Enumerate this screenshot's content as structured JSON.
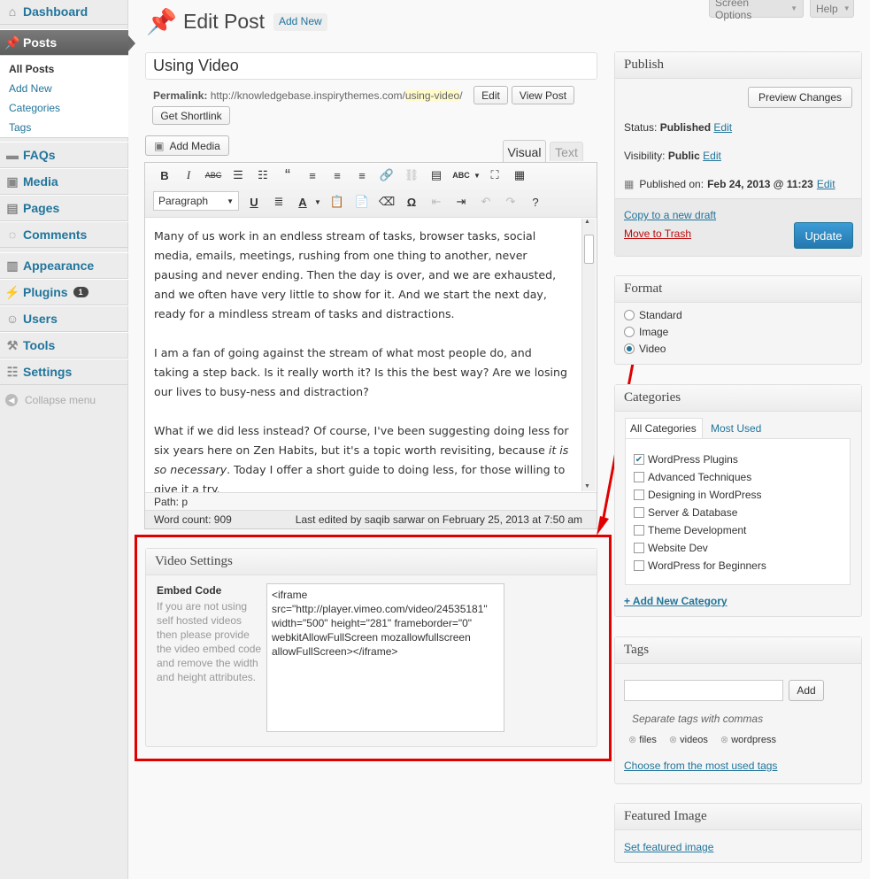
{
  "sidebar": {
    "dashboard": "Dashboard",
    "posts": "Posts",
    "sub_items": [
      "All Posts",
      "Add New",
      "Categories",
      "Tags"
    ],
    "faqs": "FAQs",
    "media": "Media",
    "pages": "Pages",
    "comments": "Comments",
    "appearance": "Appearance",
    "plugins": "Plugins",
    "plugins_badge": "1",
    "users": "Users",
    "tools": "Tools",
    "settings": "Settings",
    "collapse": "Collapse menu"
  },
  "header": {
    "title": "Edit Post",
    "add_new": "Add New",
    "screen_options": "Screen Options",
    "help": "Help"
  },
  "post": {
    "title_value": "Using Video",
    "permalink_label": "Permalink:",
    "permalink_base": "http://knowledgebase.inspirythemes.com/",
    "permalink_slug": "using-video",
    "permalink_tail": "/",
    "edit": "Edit",
    "view_post": "View Post",
    "get_shortlink": "Get Shortlink"
  },
  "editor": {
    "add_media": "Add Media",
    "tab_visual": "Visual",
    "tab_text": "Text",
    "format_select": "Paragraph",
    "para1": "Many of us work in an endless stream of tasks, browser tasks, social media, emails, meetings, rushing from one thing to another, never pausing and never ending. Then the day is over, and we are exhausted, and we often have very little to show for it. And we start the next day, ready for a mindless stream of tasks and distractions.",
    "para2": "I am a fan of going against the stream of what most people do, and taking a step back. Is it really worth it? Is this the best way? Are we losing our lives to busy-ness and distraction?",
    "para3_a": "What if we did less instead? Of course, I've been suggesting doing less for six years here on Zen Habits, but it's a topic worth revisiting, because ",
    "para3_em": "it is so necessary",
    "para3_b": ". Today I offer a short guide to doing less, for those willing to give it a try.",
    "path": "Path: p",
    "word_count": "Word count: 909",
    "last_edited": "Last edited by saqib sarwar on February 25, 2013 at 7:50 am"
  },
  "video_settings": {
    "title": "Video Settings",
    "embed_label": "Embed Code",
    "embed_desc": "If you are not using self hosted videos then please provide the video embed code and remove the width and height attributes.",
    "embed_value": "<iframe src=\"http://player.vimeo.com/video/24535181\" width=\"500\" height=\"281\" frameborder=\"0\" webkitAllowFullScreen mozallowfullscreen allowFullScreen></iframe>"
  },
  "publish": {
    "title": "Publish",
    "preview": "Preview Changes",
    "status_label": "Status:",
    "status_value": "Published",
    "visibility_label": "Visibility:",
    "visibility_value": "Public",
    "published_label": "Published on:",
    "published_value": "Feb 24, 2013 @ 11:23",
    "edit": "Edit",
    "copy_draft": "Copy to a new draft",
    "trash": "Move to Trash",
    "update": "Update"
  },
  "format": {
    "title": "Format",
    "options": [
      "Standard",
      "Image",
      "Video"
    ],
    "selected": "Video"
  },
  "categories": {
    "title": "Categories",
    "tab_all": "All Categories",
    "tab_used": "Most Used",
    "items": [
      {
        "label": "WordPress Plugins",
        "checked": true
      },
      {
        "label": "Advanced Techniques",
        "checked": false
      },
      {
        "label": "Designing in WordPress",
        "checked": false
      },
      {
        "label": "Server & Database",
        "checked": false
      },
      {
        "label": "Theme Development",
        "checked": false
      },
      {
        "label": "Website Dev",
        "checked": false
      },
      {
        "label": "WordPress for Beginners",
        "checked": false
      }
    ],
    "add_new": "+ Add New Category"
  },
  "tags": {
    "title": "Tags",
    "input_value": "",
    "add": "Add",
    "hint": "Separate tags with commas",
    "items": [
      "files",
      "videos",
      "wordpress"
    ],
    "choose": "Choose from the most used tags"
  },
  "featured": {
    "title": "Featured Image",
    "set": "Set featured image"
  },
  "colors": {
    "link": "#21759b",
    "highlight_box": "#e00000",
    "update_button": "#2e8cc8",
    "trash": "#bc0b0b"
  }
}
